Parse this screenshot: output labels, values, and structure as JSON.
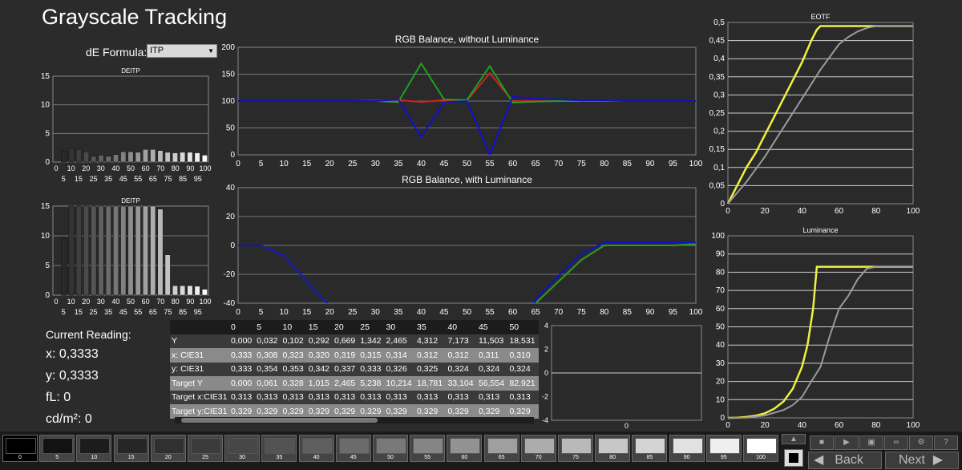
{
  "title": "Grayscale Tracking",
  "de_formula": {
    "label": "dE Formula:",
    "value": "ITP"
  },
  "colors": {
    "red": "#d32020",
    "green": "#20a020",
    "blue": "#1010d0",
    "yellow": "#f0f040",
    "gray": "#9a9a9a",
    "ref": "#d0d0d0"
  },
  "charts": {
    "de1": {
      "title": "DEITP",
      "ylim": [
        0,
        15
      ],
      "yticks": [
        "0",
        "5",
        "10",
        "15"
      ],
      "xticks_top": [
        "0",
        "10",
        "20",
        "30",
        "40",
        "50",
        "60",
        "70",
        "80",
        "90",
        "100"
      ],
      "xticks_bottom": [
        "5",
        "15",
        "25",
        "35",
        "45",
        "55",
        "65",
        "75",
        "85",
        "95"
      ]
    },
    "de2": {
      "title": "DEITP",
      "ylim": [
        0,
        15
      ],
      "yticks": [
        "0",
        "5",
        "10",
        "15"
      ],
      "xticks_top": [
        "0",
        "10",
        "20",
        "30",
        "40",
        "50",
        "60",
        "70",
        "80",
        "90",
        "100"
      ],
      "xticks_bottom": [
        "5",
        "15",
        "25",
        "35",
        "45",
        "55",
        "65",
        "75",
        "85",
        "95"
      ]
    },
    "rgb1": {
      "title": "RGB Balance, without Luminance",
      "yticks": [
        "0",
        "50",
        "100",
        "150",
        "200"
      ],
      "xticks": [
        "0",
        "5",
        "10",
        "15",
        "20",
        "25",
        "30",
        "35",
        "40",
        "45",
        "50",
        "55",
        "60",
        "65",
        "70",
        "75",
        "80",
        "85",
        "90",
        "95",
        "100"
      ]
    },
    "rgb2": {
      "title": "RGB Balance, with Luminance",
      "yticks": [
        "-40",
        "-20",
        "0",
        "20",
        "40"
      ],
      "xticks": [
        "0",
        "5",
        "10",
        "15",
        "20",
        "25",
        "30",
        "35",
        "40",
        "45",
        "50",
        "55",
        "60",
        "65",
        "70",
        "75",
        "80",
        "85",
        "90",
        "95",
        "100"
      ]
    },
    "mini": {
      "yticks": [
        "-4",
        "-2",
        "0",
        "2",
        "4"
      ],
      "xlabel": "0"
    },
    "eotf": {
      "title": "EOTF",
      "yticks": [
        "0",
        "0,05",
        "0,1",
        "0,15",
        "0,2",
        "0,25",
        "0,3",
        "0,35",
        "0,4",
        "0,45",
        "0,5"
      ],
      "xticks": [
        "0",
        "20",
        "40",
        "60",
        "80",
        "100"
      ]
    },
    "lum": {
      "title": "Luminance",
      "yticks": [
        "0",
        "10",
        "20",
        "30",
        "40",
        "50",
        "60",
        "70",
        "80",
        "90",
        "100"
      ],
      "xticks": [
        "0",
        "20",
        "40",
        "60",
        "80",
        "100"
      ]
    }
  },
  "chart_data": [
    {
      "type": "bar",
      "title": "DEITP",
      "ylim": [
        0,
        15
      ],
      "categories": [
        "0",
        "5",
        "10",
        "15",
        "20",
        "25",
        "30",
        "35",
        "40",
        "45",
        "50",
        "55",
        "60",
        "65",
        "70",
        "75",
        "80",
        "85",
        "90",
        "95",
        "100"
      ],
      "values": [
        0,
        1.9,
        2.4,
        2.2,
        1.8,
        1.0,
        1.2,
        1.0,
        1.3,
        1.8,
        1.8,
        1.7,
        2.2,
        2.2,
        2.0,
        1.7,
        1.6,
        1.7,
        1.7,
        1.6,
        1.2
      ]
    },
    {
      "type": "bar",
      "title": "DEITP",
      "ylim": [
        0,
        15
      ],
      "categories": [
        "0",
        "5",
        "10",
        "15",
        "20",
        "25",
        "30",
        "35",
        "40",
        "45",
        "50",
        "55",
        "60",
        "65",
        "70",
        "75",
        "80",
        "85",
        "90",
        "95",
        "100"
      ],
      "values": [
        0,
        9.5,
        15,
        15,
        15,
        15,
        15,
        15,
        15,
        15,
        15,
        15,
        15,
        15,
        14.5,
        6.8,
        1.6,
        1.6,
        1.6,
        1.5,
        1.0
      ]
    },
    {
      "type": "line",
      "title": "RGB Balance, without Luminance",
      "ylim": [
        0,
        200
      ],
      "x": [
        0,
        5,
        10,
        15,
        20,
        25,
        30,
        35,
        40,
        45,
        50,
        55,
        60,
        65,
        70,
        75,
        80,
        85,
        90,
        95,
        100
      ],
      "series": [
        {
          "name": "R",
          "values": [
            100,
            100,
            100,
            100,
            100,
            100,
            101,
            102,
            98,
            102,
            101,
            152,
            100,
            100,
            100,
            100,
            100,
            100,
            100,
            100,
            100
          ]
        },
        {
          "name": "G",
          "values": [
            100,
            100,
            100,
            100,
            100,
            100,
            100,
            98,
            170,
            103,
            102,
            165,
            97,
            99,
            100,
            100,
            100,
            100,
            100,
            100,
            100
          ]
        },
        {
          "name": "B",
          "values": [
            100,
            100,
            100,
            100,
            100,
            100,
            100,
            103,
            33,
            98,
            100,
            0,
            108,
            104,
            103,
            101,
            101,
            100,
            100,
            100,
            100
          ]
        }
      ]
    },
    {
      "type": "line",
      "title": "RGB Balance, with Luminance",
      "ylim": [
        -40,
        40
      ],
      "x": [
        0,
        5,
        10,
        15,
        20,
        25,
        30,
        35,
        40,
        45,
        50,
        55,
        60,
        65,
        70,
        75,
        80,
        85,
        90,
        95,
        100
      ],
      "series": [
        {
          "name": "R",
          "values": [
            0,
            0,
            -7,
            -25,
            -42,
            -60,
            -80,
            -100,
            -100,
            -100,
            -100,
            -100,
            -100,
            -40,
            -25,
            -10,
            0,
            0,
            0,
            0,
            1
          ]
        },
        {
          "name": "G",
          "values": [
            0,
            0,
            -7,
            -25,
            -42,
            -60,
            -80,
            -100,
            -100,
            -100,
            -100,
            -100,
            -100,
            -40,
            -25,
            -10,
            0,
            0,
            0,
            0,
            1
          ]
        },
        {
          "name": "B",
          "values": [
            0,
            0,
            -7,
            -25,
            -42,
            -60,
            -80,
            -100,
            -100,
            -100,
            -100,
            -100,
            -100,
            -37,
            -21,
            -6,
            2,
            2,
            2,
            2,
            2
          ]
        }
      ]
    },
    {
      "type": "line",
      "title": "EOTF",
      "ylim": [
        0,
        0.5
      ],
      "xlim": [
        0,
        100
      ],
      "series": [
        {
          "name": "Measured",
          "x": [
            0,
            5,
            10,
            15,
            20,
            25,
            30,
            35,
            40,
            45,
            48,
            50,
            60,
            70,
            80,
            90,
            100
          ],
          "values": [
            0,
            0.05,
            0.1,
            0.14,
            0.19,
            0.24,
            0.29,
            0.34,
            0.39,
            0.45,
            0.48,
            0.49,
            0.49,
            0.49,
            0.49,
            0.49,
            0.49
          ]
        },
        {
          "name": "Target",
          "x": [
            0,
            5,
            10,
            20,
            30,
            40,
            50,
            60,
            65,
            70,
            75,
            80,
            90,
            100
          ],
          "values": [
            0,
            0.03,
            0.06,
            0.13,
            0.21,
            0.29,
            0.37,
            0.44,
            0.46,
            0.475,
            0.485,
            0.49,
            0.49,
            0.49
          ]
        }
      ]
    },
    {
      "type": "line",
      "title": "Luminance",
      "ylim": [
        0,
        100
      ],
      "xlim": [
        0,
        100
      ],
      "series": [
        {
          "name": "Measured",
          "x": [
            0,
            5,
            10,
            15,
            20,
            25,
            30,
            35,
            40,
            43,
            46,
            48,
            50,
            60,
            70,
            80,
            90,
            100
          ],
          "values": [
            0,
            0.1,
            0.5,
            1.2,
            2.5,
            5,
            9,
            16,
            28,
            40,
            60,
            83,
            83,
            83,
            83,
            83,
            83,
            83
          ]
        },
        {
          "name": "Target",
          "x": [
            0,
            10,
            20,
            30,
            35,
            40,
            45,
            50,
            55,
            60,
            65,
            70,
            75,
            80,
            90,
            100
          ],
          "values": [
            0,
            0.1,
            1.3,
            4.3,
            7,
            11.5,
            20,
            28,
            45,
            60,
            67,
            76,
            82,
            83,
            83,
            83
          ]
        }
      ]
    }
  ],
  "readings": {
    "heading": "Current Reading:",
    "x": "x: 0,3333",
    "y": "y: 0,3333",
    "fl": "fL: 0",
    "cd": "cd/m²: 0"
  },
  "table": {
    "columns": [
      "",
      "0",
      "5",
      "10",
      "15",
      "20",
      "25",
      "30",
      "35",
      "40",
      "45",
      "50"
    ],
    "rows": [
      [
        "Y",
        "0,000",
        "0,032",
        "0,102",
        "0,292",
        "0,669",
        "1,342",
        "2,465",
        "4,312",
        "7,173",
        "11,503",
        "18,531"
      ],
      [
        "x: CIE31",
        "0,333",
        "0,308",
        "0,323",
        "0,320",
        "0,319",
        "0,315",
        "0,314",
        "0,312",
        "0,312",
        "0,311",
        "0,310"
      ],
      [
        "y: CIE31",
        "0,333",
        "0,354",
        "0,353",
        "0,342",
        "0,337",
        "0,333",
        "0,326",
        "0,325",
        "0,324",
        "0,324",
        "0,324"
      ],
      [
        "Target Y",
        "0,000",
        "0,061",
        "0,328",
        "1,015",
        "2,465",
        "5,238",
        "10,214",
        "18,781",
        "33,104",
        "56,554",
        "82,921"
      ],
      [
        "Target x:CIE31",
        "0,313",
        "0,313",
        "0,313",
        "0,313",
        "0,313",
        "0,313",
        "0,313",
        "0,313",
        "0,313",
        "0,313",
        "0,313"
      ],
      [
        "Target y:CIE31",
        "0,329",
        "0,329",
        "0,329",
        "0,329",
        "0,329",
        "0,329",
        "0,329",
        "0,329",
        "0,329",
        "0,329",
        "0,329"
      ]
    ]
  },
  "patches": [
    {
      "label": "0",
      "color": "#000000",
      "selected": true
    },
    {
      "label": "5",
      "color": "#121212"
    },
    {
      "label": "10",
      "color": "#1c1c1c"
    },
    {
      "label": "15",
      "color": "#262626"
    },
    {
      "label": "20",
      "color": "#303030"
    },
    {
      "label": "25",
      "color": "#3b3b3b"
    },
    {
      "label": "30",
      "color": "#474747"
    },
    {
      "label": "35",
      "color": "#535353"
    },
    {
      "label": "40",
      "color": "#5f5f5f"
    },
    {
      "label": "45",
      "color": "#6b6b6b"
    },
    {
      "label": "50",
      "color": "#787878"
    },
    {
      "label": "55",
      "color": "#858585"
    },
    {
      "label": "60",
      "color": "#929292"
    },
    {
      "label": "65",
      "color": "#9f9f9f"
    },
    {
      "label": "70",
      "color": "#acacac"
    },
    {
      "label": "75",
      "color": "#b9b9b9"
    },
    {
      "label": "80",
      "color": "#c7c7c7"
    },
    {
      "label": "85",
      "color": "#d4d4d4"
    },
    {
      "label": "90",
      "color": "#e1e1e1"
    },
    {
      "label": "95",
      "color": "#efefef"
    },
    {
      "label": "100",
      "color": "#ffffff"
    }
  ],
  "nav": {
    "back": "Back",
    "next": "Next"
  }
}
